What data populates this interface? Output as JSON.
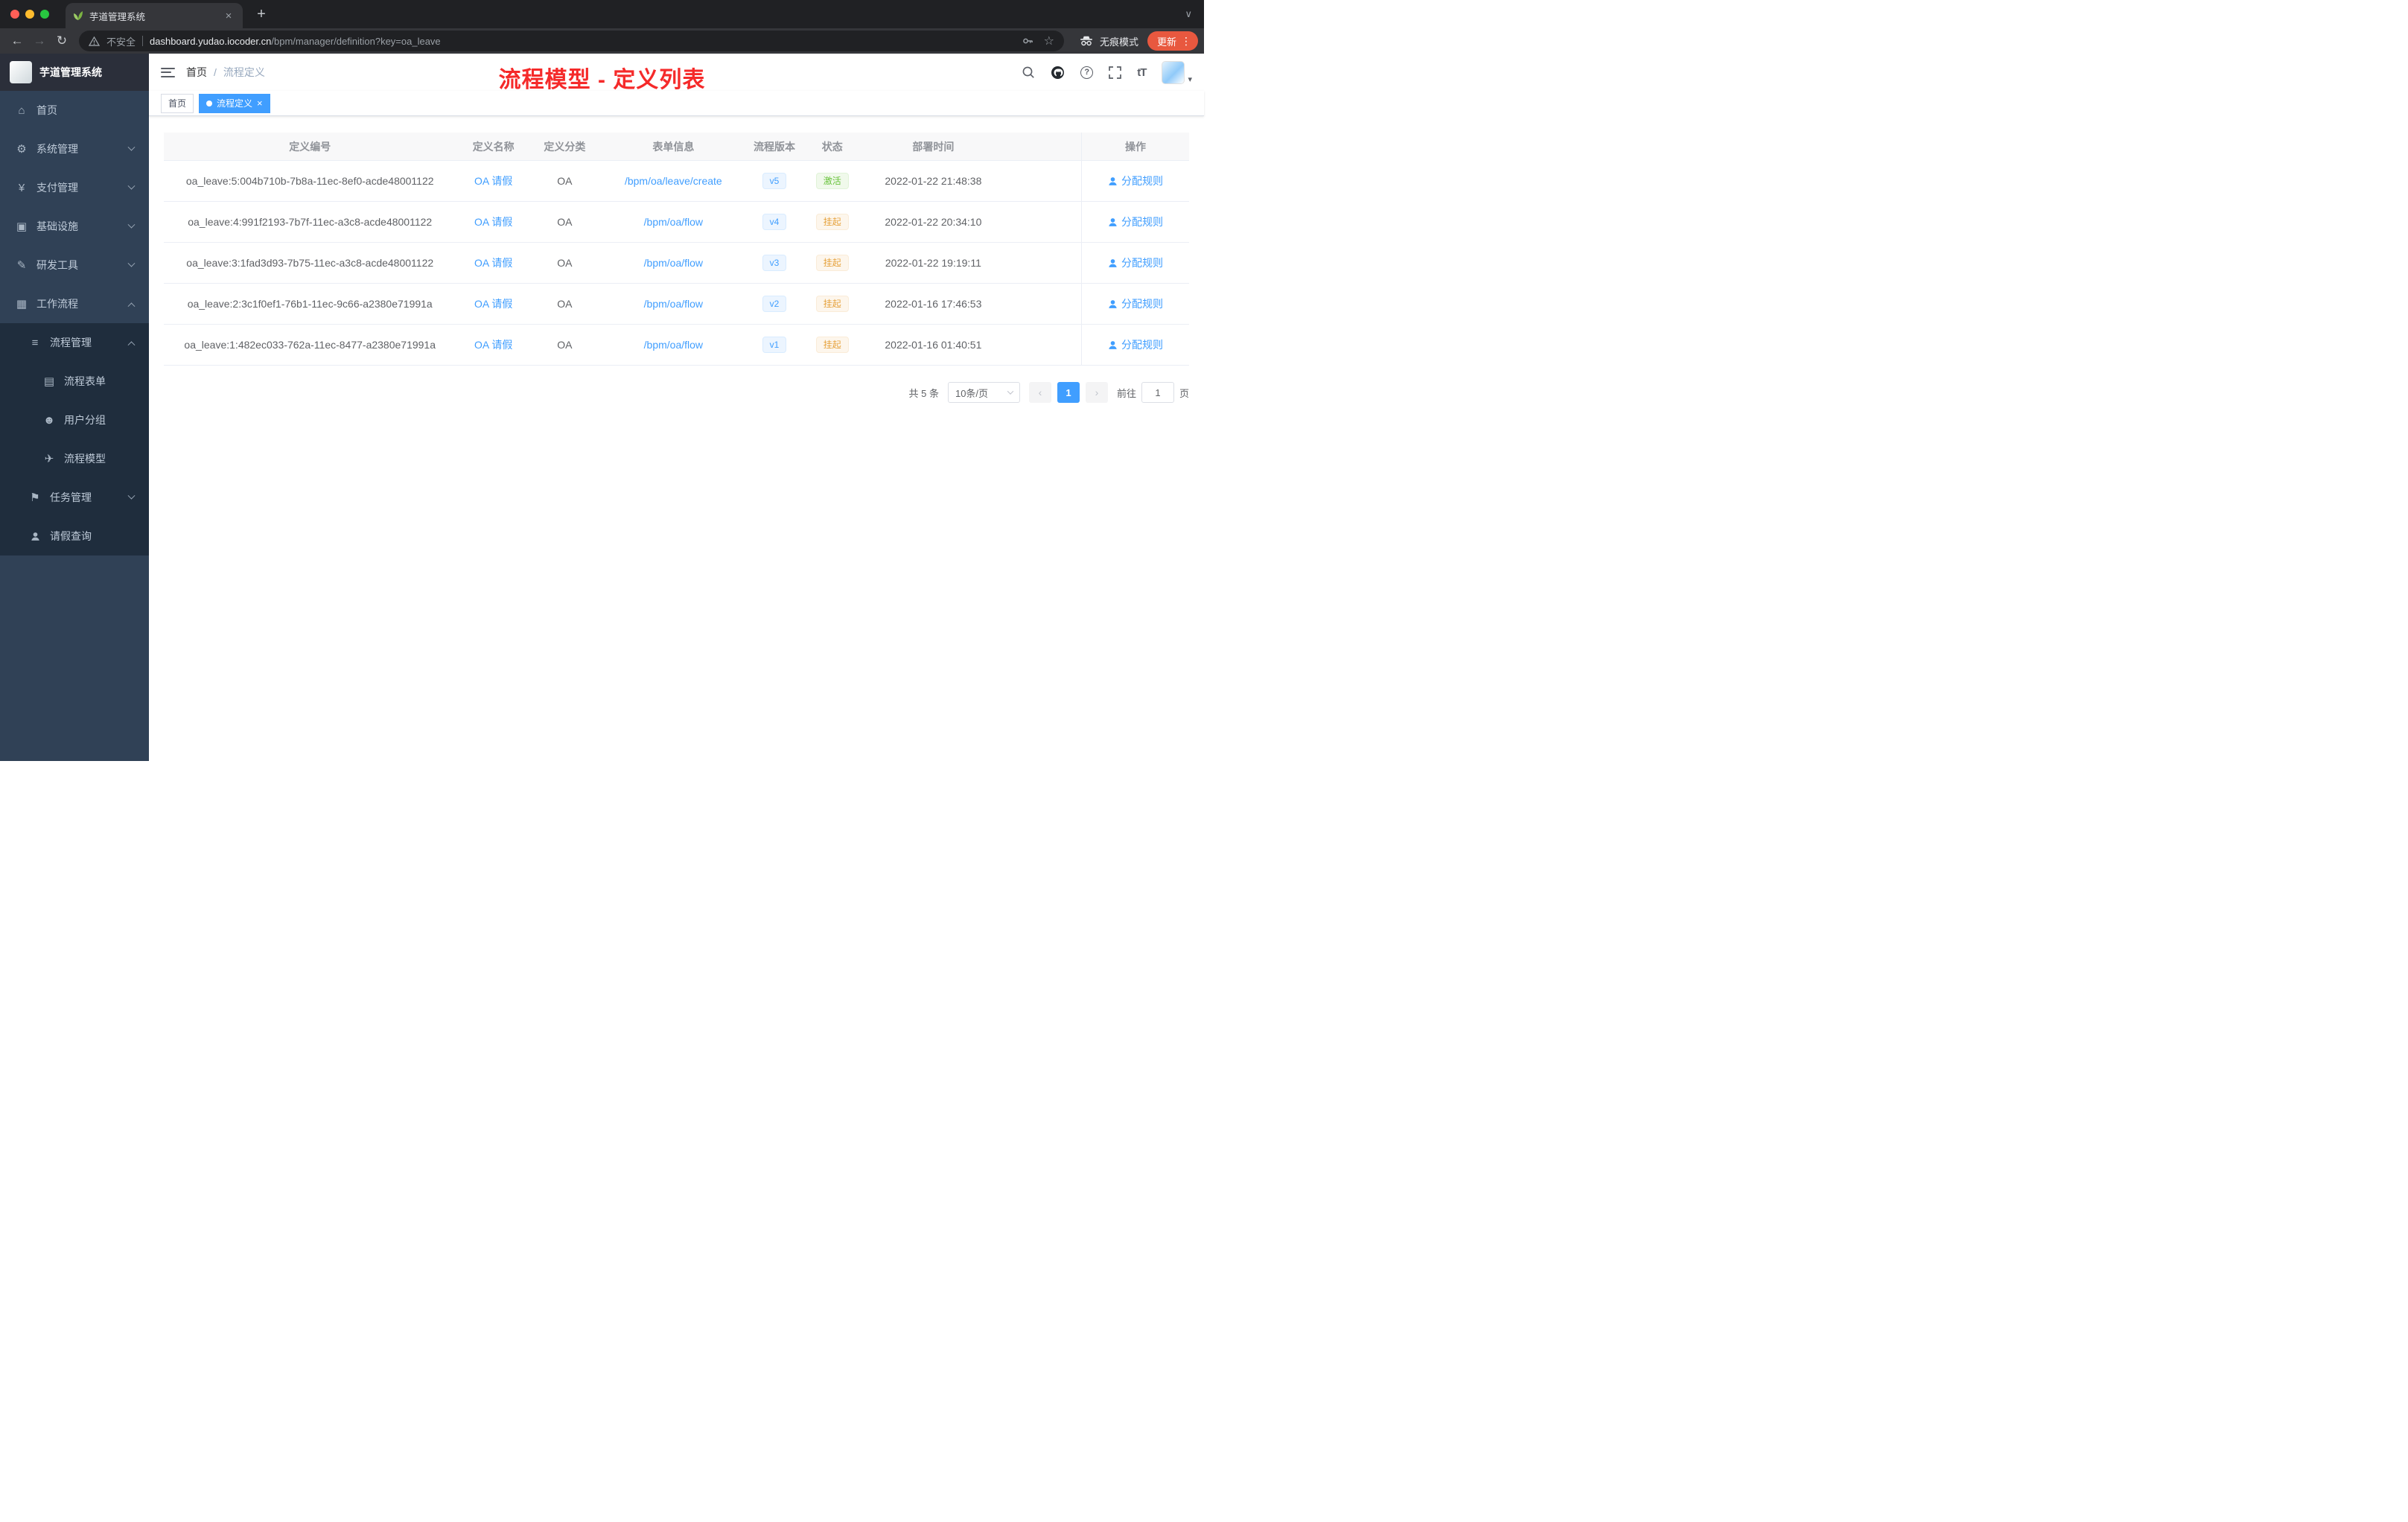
{
  "colors": {
    "accent": "#409eff",
    "success": "#67c23a",
    "warning": "#e6a23c",
    "annotation_red": "#f52a2a",
    "sidebar_bg": "#304156",
    "submenu_bg": "#1f2d3d",
    "update_button": "#e8583f"
  },
  "icons": {
    "back": "←",
    "forward": "→",
    "reload": "↻",
    "star": "☆",
    "menu_dots": "⋮",
    "new_tab": "+",
    "close": "×",
    "tab_search": "∨",
    "caret_down": "▾",
    "home": "⌂",
    "gear": "⚙",
    "yen": "¥",
    "infra": "▣",
    "tools": "✎",
    "workflow": "▦",
    "list": "≡",
    "form": "▤",
    "users": "☻",
    "model": "✈",
    "tasks": "⚑",
    "question": "?",
    "font_size": "tT"
  },
  "browser": {
    "tab_title": "芋道管理系统",
    "security_label": "不安全",
    "url_domain": "dashboard.yudao.iocoder.cn",
    "url_path": "/bpm/manager/definition?key=oa_leave",
    "incognito_label": "无痕模式",
    "update_label": "更新"
  },
  "sidebar": {
    "logo_title": "芋道管理系统",
    "menu": [
      {
        "label": "首页"
      },
      {
        "label": "系统管理"
      },
      {
        "label": "支付管理"
      },
      {
        "label": "基础设施"
      },
      {
        "label": "研发工具"
      },
      {
        "label": "工作流程"
      },
      {
        "label": "流程管理"
      },
      {
        "label": "流程表单"
      },
      {
        "label": "用户分组"
      },
      {
        "label": "流程模型"
      },
      {
        "label": "任务管理"
      },
      {
        "label": "请假查询"
      }
    ]
  },
  "header": {
    "breadcrumb_home": "首页",
    "breadcrumb_separator": "/",
    "breadcrumb_current": "流程定义",
    "annotation": "流程模型 - 定义列表"
  },
  "tags": [
    {
      "label": "首页"
    },
    {
      "label": "流程定义"
    }
  ],
  "table": {
    "columns": [
      "定义编号",
      "定义名称",
      "定义分类",
      "表单信息",
      "流程版本",
      "状态",
      "部署时间",
      "操作"
    ],
    "rows": [
      {
        "id": "oa_leave:5:004b710b-7b8a-11ec-8ef0-acde48001122",
        "name": "OA 请假",
        "category": "OA",
        "form": "/bpm/oa/leave/create",
        "version": "v5",
        "status": "激活",
        "status_type": "success",
        "time": "2022-01-22 21:48:38",
        "action": "分配规则"
      },
      {
        "id": "oa_leave:4:991f2193-7b7f-11ec-a3c8-acde48001122",
        "name": "OA 请假",
        "category": "OA",
        "form": "/bpm/oa/flow",
        "version": "v4",
        "status": "挂起",
        "status_type": "warning",
        "time": "2022-01-22 20:34:10",
        "action": "分配规则"
      },
      {
        "id": "oa_leave:3:1fad3d93-7b75-11ec-a3c8-acde48001122",
        "name": "OA 请假",
        "category": "OA",
        "form": "/bpm/oa/flow",
        "version": "v3",
        "status": "挂起",
        "status_type": "warning",
        "time": "2022-01-22 19:19:11",
        "action": "分配规则"
      },
      {
        "id": "oa_leave:2:3c1f0ef1-76b1-11ec-9c66-a2380e71991a",
        "name": "OA 请假",
        "category": "OA",
        "form": "/bpm/oa/flow",
        "version": "v2",
        "status": "挂起",
        "status_type": "warning",
        "time": "2022-01-16 17:46:53",
        "action": "分配规则"
      },
      {
        "id": "oa_leave:1:482ec033-762a-11ec-8477-a2380e71991a",
        "name": "OA 请假",
        "category": "OA",
        "form": "/bpm/oa/flow",
        "version": "v1",
        "status": "挂起",
        "status_type": "warning",
        "time": "2022-01-16 01:40:51",
        "action": "分配规则"
      }
    ]
  },
  "pagination": {
    "total": "共 5 条",
    "page_size": "10条/页",
    "prev": "‹",
    "page": "1",
    "next": "›",
    "goto_prefix": "前往",
    "goto_value": "1",
    "goto_suffix": "页"
  }
}
